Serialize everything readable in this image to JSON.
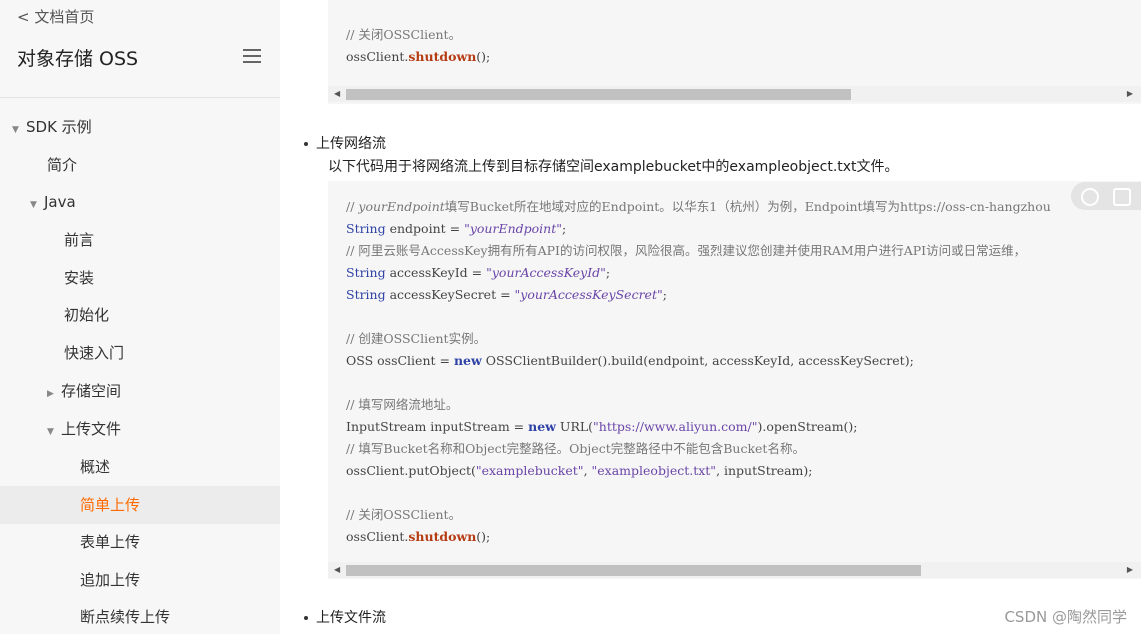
{
  "sidebar": {
    "back_label": "< 文档首页",
    "product_title": "对象存储 OSS",
    "menu_icon": "hamburger-menu-icon",
    "items": [
      {
        "label": "SDK 示例",
        "caret": "▼"
      },
      {
        "label": "简介",
        "caret": ""
      },
      {
        "label": "Java",
        "caret": "▼"
      },
      {
        "label": "前言",
        "caret": ""
      },
      {
        "label": "安装",
        "caret": ""
      },
      {
        "label": "初始化",
        "caret": ""
      },
      {
        "label": "快速入门",
        "caret": ""
      },
      {
        "label": "存储空间",
        "caret": "▶"
      },
      {
        "label": "上传文件",
        "caret": "▼"
      },
      {
        "label": "概述",
        "caret": ""
      },
      {
        "label": "简单上传",
        "caret": ""
      },
      {
        "label": "表单上传",
        "caret": ""
      },
      {
        "label": "追加上传",
        "caret": ""
      },
      {
        "label": "断点续传上传",
        "caret": ""
      }
    ],
    "active_color": "#ff6a00"
  },
  "main": {
    "top_code": {
      "line1": "// 关闭OSSClient。",
      "line2_prefix": "ossClient.",
      "line2_fn": "shutdown",
      "line2_suffix": "();"
    },
    "section_network": {
      "bullet": "上传网络流",
      "description": "以下代码用于将网络流上传到目标存储空间examplebucket中的exampleobject.txt文件。"
    },
    "code": {
      "c1_prefix": "// ",
      "c1_var": "yourEndpoint",
      "c1_rest": "填写Bucket所在地域对应的Endpoint。以华东1（杭州）为例，Endpoint填写为https://oss-cn-hangzhou",
      "l2_type": "String",
      "l2_mid": " endpoint = ",
      "l2_str": "\"yourEndpoint\"",
      "l2_end": ";",
      "c3": "// 阿里云账号AccessKey拥有所有API的访问权限，风险很高。强烈建议您创建并使用RAM用户进行API访问或日常运维，",
      "l4_type": "String",
      "l4_mid": " accessKeyId = ",
      "l4_str": "\"yourAccessKeyId\"",
      "l4_end": ";",
      "l5_type": "String",
      "l5_mid": " accessKeySecret = ",
      "l5_str": "\"yourAccessKeySecret\"",
      "l5_end": ";",
      "c6": "// 创建OSSClient实例。",
      "l7_pre": "OSS ossClient = ",
      "l7_kw": "new",
      "l7_post": " OSSClientBuilder().build(endpoint, accessKeyId, accessKeySecret);",
      "c8": "// 填写网络流地址。",
      "l9_pre": "InputStream inputStream = ",
      "l9_kw": "new",
      "l9_mid": " URL(",
      "l9_str": "\"https://www.aliyun.com/\"",
      "l9_post": ").openStream();",
      "c10": "// 填写Bucket名称和Object完整路径。Object完整路径中不能包含Bucket名称。",
      "l11_pre": "ossClient.putObject(",
      "l11_s1": "\"examplebucket\"",
      "l11_sep": ", ",
      "l11_s2": "\"exampleobject.txt\"",
      "l11_post": ", inputStream);",
      "c12": "// 关闭OSSClient。",
      "l13_prefix": "ossClient.",
      "l13_fn": "shutdown",
      "l13_suffix": "();"
    },
    "section_file": {
      "bullet": "上传文件流"
    },
    "scrollbar_top_thumb": 0.65,
    "scrollbar_bottom_thumb": 0.74,
    "toolbar_icons": [
      "toggle-icon",
      "copy-icon"
    ]
  },
  "watermark": "CSDN @陶然同学"
}
